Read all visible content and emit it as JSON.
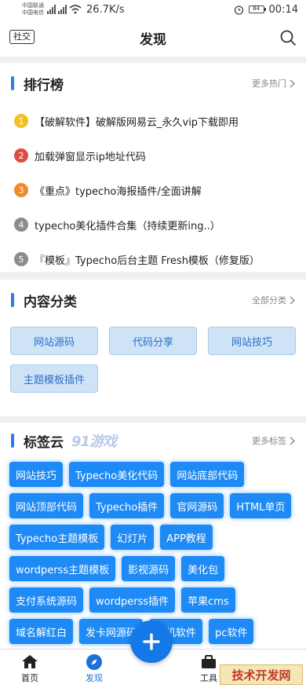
{
  "status": {
    "carrier1": "中国联通",
    "carrier2": "中国电信",
    "speed": "26.7K/s",
    "battery": "84",
    "time": "00:14"
  },
  "header": {
    "social_label": "社交",
    "title": "发现"
  },
  "ranking": {
    "title": "排行榜",
    "more": "更多热门",
    "items": [
      {
        "num": "1",
        "text": "【破解软件】破解版网易云_永久vip下载即用",
        "color": "#f2c029"
      },
      {
        "num": "2",
        "text": "加载弹窗显示ip地址代码",
        "color": "#e04b3f"
      },
      {
        "num": "3",
        "text": "《重点》typecho海报插件/全面讲解",
        "color": "#f08a2b"
      },
      {
        "num": "4",
        "text": "typecho美化插件合集（持续更新ing..）",
        "color": "#8c8c8c"
      },
      {
        "num": "5",
        "text": "『模板』Typecho后台主题 Fresh模板（修复版）",
        "color": "#8c8c8c"
      }
    ]
  },
  "categories": {
    "title": "内容分类",
    "more": "全部分类",
    "items": [
      "网站源码",
      "代码分享",
      "网站技巧",
      "主题模板插件"
    ]
  },
  "tags": {
    "title": "标签云",
    "logo": "91游戏",
    "more": "更多标签",
    "items": [
      "网站技巧",
      "Typecho美化代码",
      "网站底部代码",
      "网站顶部代码",
      "Typecho插件",
      "官网源码",
      "HTML单页",
      "Typecho主题模板",
      "幻灯片",
      "APP教程",
      "wordperss主题模板",
      "影视源码",
      "美化包",
      "支付系统源码",
      "wordperss插件",
      "苹果cms",
      "域名解红白",
      "发卡网源码",
      "手机软件",
      "pc软件"
    ]
  },
  "tabbar": {
    "home": "首页",
    "discover": "发现",
    "tools": "工具"
  },
  "watermark": "技术开发网",
  "colors": {
    "accent": "#1e8af5",
    "section_bar": "#2b7de9"
  }
}
